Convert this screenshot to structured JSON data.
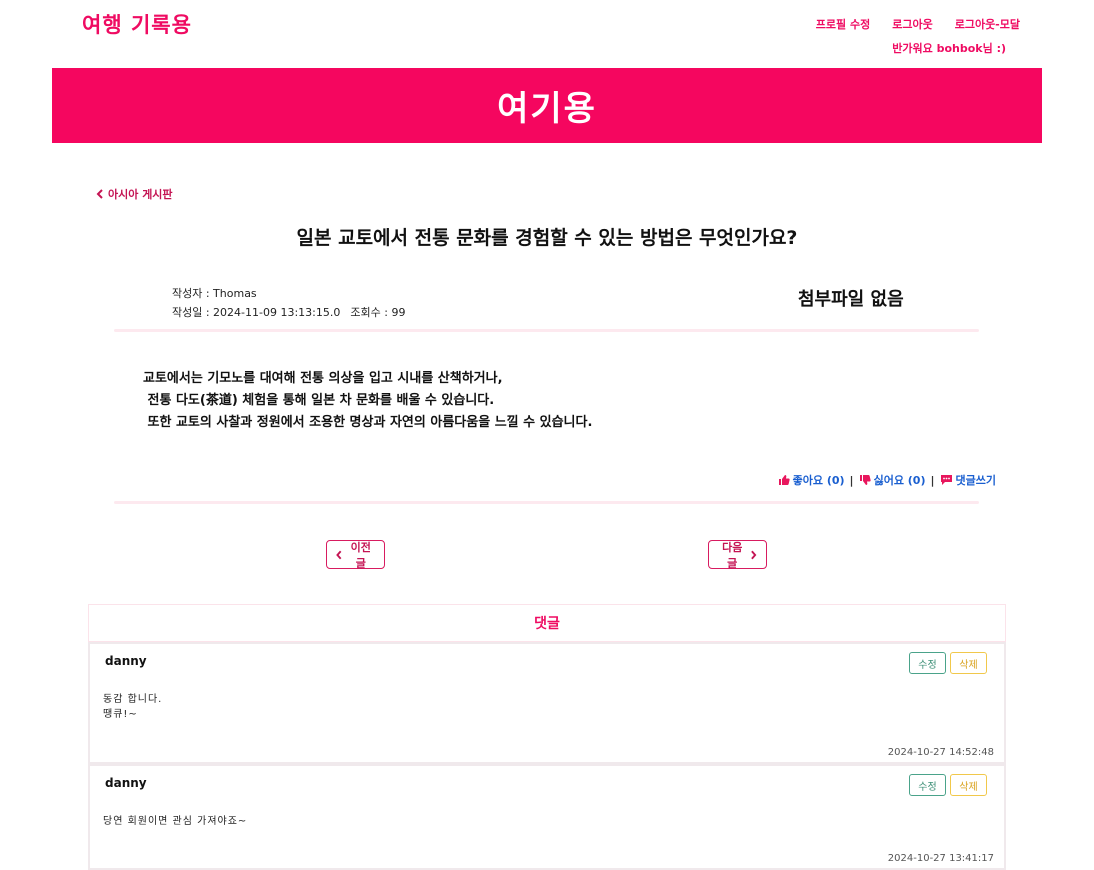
{
  "header": {
    "logo": "여행 기록용",
    "nav": [
      "프로필 수정",
      "로그아웃",
      "로그아웃-모달"
    ],
    "greeting": "반가워요 bohbok님 :)"
  },
  "banner": {
    "title": "여기용"
  },
  "board": {
    "back_label": "아시아 게시판"
  },
  "post": {
    "title": "일본 교토에서 전통 문화를 경험할 수 있는 방법은 무엇인가요?",
    "author_line": "작성자 : Thomas",
    "date_line": "작성일 : 2024-11-09 13:13:15.0",
    "views_line": "조회수 : 99",
    "attachment": "첨부파일 없음",
    "content": "교토에서는 기모노를 대여해 전통 의상을 입고 시내를 산책하거나,\n 전통 다도(茶道) 체험을 통해 일본 차 문화를 배울 수 있습니다.\n 또한 교토의 사찰과 정원에서 조용한 명상과 자연의 아름다움을 느낄 수 있습니다."
  },
  "reactions": {
    "like_label": "좋아요 (0)",
    "dislike_label": "싫어요 (0)",
    "comment_label": "댓글쓰기",
    "separator": "|"
  },
  "pager": {
    "prev_label": "이전글",
    "next_label": "다음글"
  },
  "comments": {
    "heading": "댓글",
    "items": [
      {
        "author": "danny",
        "text": "동감 합니다.\n땡큐!~",
        "date": "2024-10-27 14:52:48",
        "edit_label": "수정",
        "delete_label": "삭제"
      },
      {
        "author": "danny",
        "text": "당연 회원이면 관심 가져야죠~",
        "date": "2024-10-27 13:41:17",
        "edit_label": "수정",
        "delete_label": "삭제"
      }
    ]
  },
  "colors": {
    "brand": "#f5065f",
    "link": "#1a5fd0",
    "edit": "#4aa38a",
    "delete": "#f1c84b"
  },
  "icons": {
    "back": "chevron-left-icon",
    "next": "chevron-right-icon",
    "like": "thumbs-up-icon",
    "dislike": "thumbs-down-icon",
    "comment": "comment-icon"
  }
}
